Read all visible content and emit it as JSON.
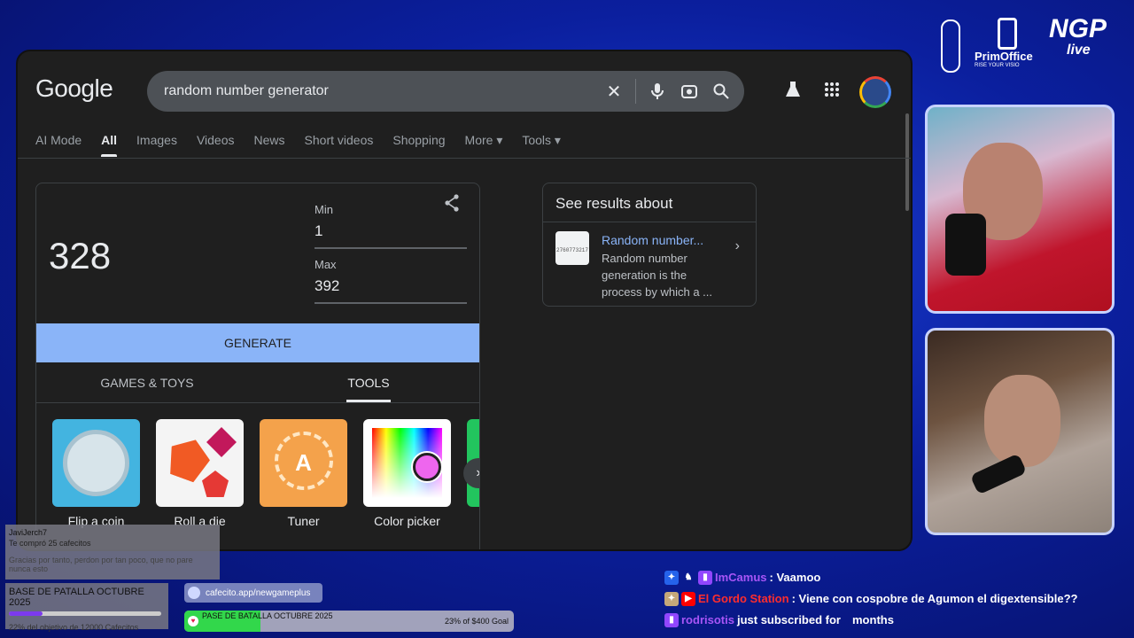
{
  "google": {
    "logo": "Google",
    "query": "random number generator",
    "tabs": [
      "AI Mode",
      "All",
      "Images",
      "Videos",
      "News",
      "Short videos",
      "Shopping",
      "More ▾",
      "Tools ▾"
    ],
    "active_tab": "All"
  },
  "rng": {
    "result": "328",
    "min_label": "Min",
    "min_value": "1",
    "max_label": "Max",
    "max_value": "392",
    "generate_label": "GENERATE",
    "subtab_games": "GAMES & TOYS",
    "subtab_tools": "TOOLS",
    "tiles": [
      "Flip a coin",
      "Roll a die",
      "Tuner",
      "Color picker"
    ],
    "tuner_letter": "A"
  },
  "knowledge_panel": {
    "title": "See results about",
    "item_title": "Random number...",
    "item_desc": "Random number generation is the process by which a ...",
    "thumb_text": "2760773217"
  },
  "overlay": {
    "brand_primoffice": "PrimOffice",
    "brand_primoffice_sub": "RISE YOUR VISIO",
    "brand_ngp": "NGP",
    "brand_ngp_sub": "live",
    "donation_user": "JaviJerch7",
    "donation_amount": "Te compró 25 cafecitos",
    "donation_msg": "Gracias por tanto, perdon por tan poco, que no pare nunca esto",
    "goal1_title": "BASE DE PATALLA OCTUBRE 2025",
    "goal1_sub": "22% del objetivo de 12000 Cafecitos",
    "goal1_progress": 0.22,
    "cafecito_url": "cafecito.app/newgameplus",
    "goal2_title": "PASE DE BATALLA OCTUBRE 2025",
    "goal2_pct": "23% of $400 Goal",
    "goal2_progress": 0.23
  },
  "chat": [
    {
      "user": "ImCamus",
      "text": ": Vaamoo"
    },
    {
      "user": "El Gordo Station",
      "text": ": Viene con cospobre de Agumon el digextensible??"
    },
    {
      "user": "rodrisotis",
      "text": " just subscribed for",
      "text2": "months"
    }
  ]
}
